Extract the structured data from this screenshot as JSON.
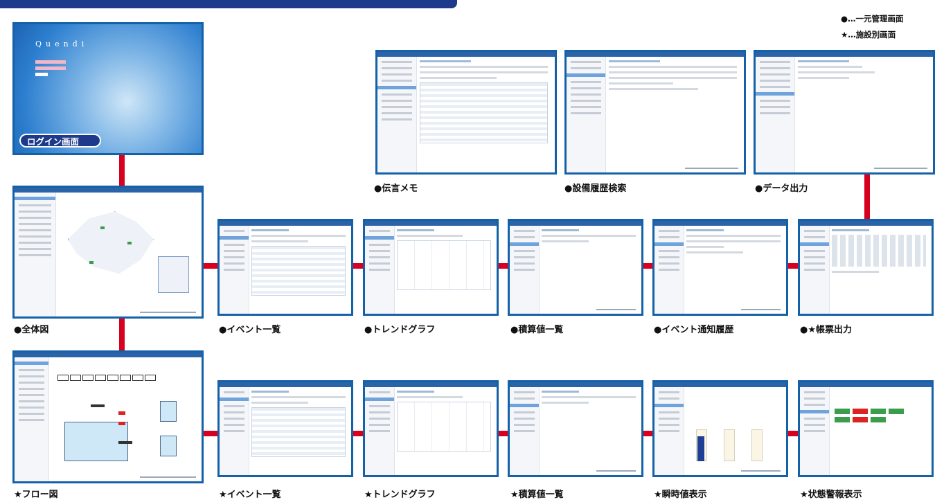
{
  "legend": {
    "unified": "●…一元管理画面",
    "facility": "★…施設別画面"
  },
  "login": {
    "logo": "Quendi",
    "badge": "ログイン画面"
  },
  "captions": {
    "memo": "●伝言メモ",
    "equipment_history": "●設備履歴検索",
    "data_output": "●データ出力",
    "overview": "●全体図",
    "event_list": "●イベント一覧",
    "trend_graph": "●トレンドグラフ",
    "integrated_values": "●積算値一覧",
    "event_notification": "●イベント通知履歴",
    "report_output": "●★帳票出力",
    "flow": "★フロー図",
    "f_event_list": "★イベント一覧",
    "f_trend_graph": "★トレンドグラフ",
    "f_integrated_values": "★積算値一覧",
    "instant_values": "★瞬時値表示",
    "status_alarm": "★状態警報表示"
  },
  "colors": {
    "frame": "#1461a8",
    "connector": "#d7001f",
    "banner": "#1e3a8a"
  }
}
